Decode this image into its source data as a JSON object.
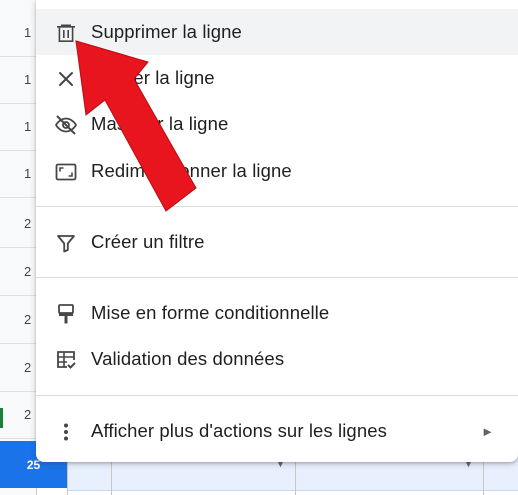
{
  "sheet": {
    "row_numbers": [
      "1",
      "1",
      "1",
      "1",
      "2",
      "2",
      "2",
      "2",
      "2"
    ],
    "selected_row_number": "25"
  },
  "menu": {
    "items": [
      {
        "label": "Supprimer la ligne",
        "icon": "trash-icon"
      },
      {
        "label": "Effacer la ligne",
        "icon": "close-icon"
      },
      {
        "label": "Masquer la ligne",
        "icon": "eye-off-icon"
      },
      {
        "label": "Redimensionner la ligne",
        "icon": "resize-icon"
      },
      {
        "label": "Créer un filtre",
        "icon": "filter-icon"
      },
      {
        "label": "Mise en forme conditionnelle",
        "icon": "paint-roller-icon"
      },
      {
        "label": "Validation des données",
        "icon": "data-validation-icon"
      },
      {
        "label": "Afficher plus d'actions sur les lignes",
        "icon": "more-vertical-icon",
        "submenu_indicator": "►"
      }
    ]
  },
  "colors": {
    "selection": "#1a73e8",
    "annotation_arrow": "#e8141e",
    "hover": "#f1f3f4"
  }
}
